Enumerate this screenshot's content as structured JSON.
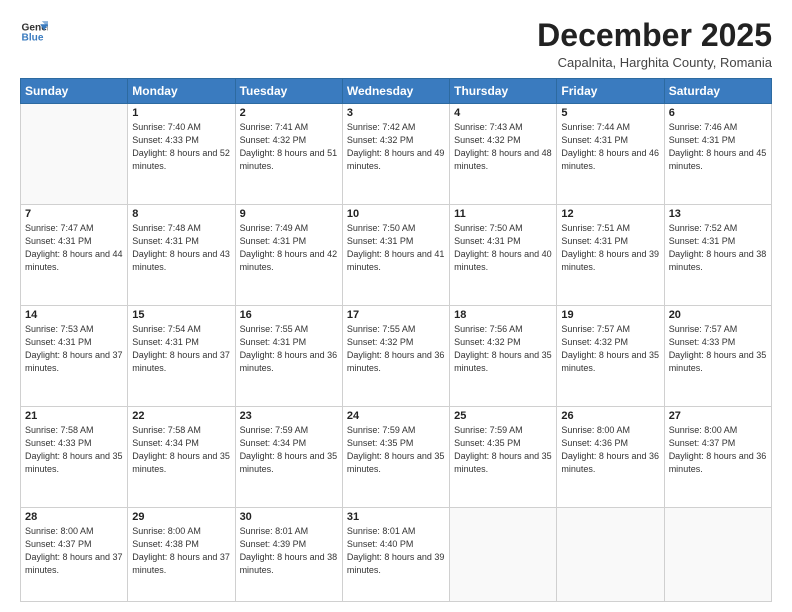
{
  "header": {
    "logo_line1": "General",
    "logo_line2": "Blue",
    "month": "December 2025",
    "location": "Capalnita, Harghita County, Romania"
  },
  "weekdays": [
    "Sunday",
    "Monday",
    "Tuesday",
    "Wednesday",
    "Thursday",
    "Friday",
    "Saturday"
  ],
  "weeks": [
    [
      {
        "day": "",
        "sunrise": "",
        "sunset": "",
        "daylight": ""
      },
      {
        "day": "1",
        "sunrise": "Sunrise: 7:40 AM",
        "sunset": "Sunset: 4:33 PM",
        "daylight": "Daylight: 8 hours and 52 minutes."
      },
      {
        "day": "2",
        "sunrise": "Sunrise: 7:41 AM",
        "sunset": "Sunset: 4:32 PM",
        "daylight": "Daylight: 8 hours and 51 minutes."
      },
      {
        "day": "3",
        "sunrise": "Sunrise: 7:42 AM",
        "sunset": "Sunset: 4:32 PM",
        "daylight": "Daylight: 8 hours and 49 minutes."
      },
      {
        "day": "4",
        "sunrise": "Sunrise: 7:43 AM",
        "sunset": "Sunset: 4:32 PM",
        "daylight": "Daylight: 8 hours and 48 minutes."
      },
      {
        "day": "5",
        "sunrise": "Sunrise: 7:44 AM",
        "sunset": "Sunset: 4:31 PM",
        "daylight": "Daylight: 8 hours and 46 minutes."
      },
      {
        "day": "6",
        "sunrise": "Sunrise: 7:46 AM",
        "sunset": "Sunset: 4:31 PM",
        "daylight": "Daylight: 8 hours and 45 minutes."
      }
    ],
    [
      {
        "day": "7",
        "sunrise": "Sunrise: 7:47 AM",
        "sunset": "Sunset: 4:31 PM",
        "daylight": "Daylight: 8 hours and 44 minutes."
      },
      {
        "day": "8",
        "sunrise": "Sunrise: 7:48 AM",
        "sunset": "Sunset: 4:31 PM",
        "daylight": "Daylight: 8 hours and 43 minutes."
      },
      {
        "day": "9",
        "sunrise": "Sunrise: 7:49 AM",
        "sunset": "Sunset: 4:31 PM",
        "daylight": "Daylight: 8 hours and 42 minutes."
      },
      {
        "day": "10",
        "sunrise": "Sunrise: 7:50 AM",
        "sunset": "Sunset: 4:31 PM",
        "daylight": "Daylight: 8 hours and 41 minutes."
      },
      {
        "day": "11",
        "sunrise": "Sunrise: 7:50 AM",
        "sunset": "Sunset: 4:31 PM",
        "daylight": "Daylight: 8 hours and 40 minutes."
      },
      {
        "day": "12",
        "sunrise": "Sunrise: 7:51 AM",
        "sunset": "Sunset: 4:31 PM",
        "daylight": "Daylight: 8 hours and 39 minutes."
      },
      {
        "day": "13",
        "sunrise": "Sunrise: 7:52 AM",
        "sunset": "Sunset: 4:31 PM",
        "daylight": "Daylight: 8 hours and 38 minutes."
      }
    ],
    [
      {
        "day": "14",
        "sunrise": "Sunrise: 7:53 AM",
        "sunset": "Sunset: 4:31 PM",
        "daylight": "Daylight: 8 hours and 37 minutes."
      },
      {
        "day": "15",
        "sunrise": "Sunrise: 7:54 AM",
        "sunset": "Sunset: 4:31 PM",
        "daylight": "Daylight: 8 hours and 37 minutes."
      },
      {
        "day": "16",
        "sunrise": "Sunrise: 7:55 AM",
        "sunset": "Sunset: 4:31 PM",
        "daylight": "Daylight: 8 hours and 36 minutes."
      },
      {
        "day": "17",
        "sunrise": "Sunrise: 7:55 AM",
        "sunset": "Sunset: 4:32 PM",
        "daylight": "Daylight: 8 hours and 36 minutes."
      },
      {
        "day": "18",
        "sunrise": "Sunrise: 7:56 AM",
        "sunset": "Sunset: 4:32 PM",
        "daylight": "Daylight: 8 hours and 35 minutes."
      },
      {
        "day": "19",
        "sunrise": "Sunrise: 7:57 AM",
        "sunset": "Sunset: 4:32 PM",
        "daylight": "Daylight: 8 hours and 35 minutes."
      },
      {
        "day": "20",
        "sunrise": "Sunrise: 7:57 AM",
        "sunset": "Sunset: 4:33 PM",
        "daylight": "Daylight: 8 hours and 35 minutes."
      }
    ],
    [
      {
        "day": "21",
        "sunrise": "Sunrise: 7:58 AM",
        "sunset": "Sunset: 4:33 PM",
        "daylight": "Daylight: 8 hours and 35 minutes."
      },
      {
        "day": "22",
        "sunrise": "Sunrise: 7:58 AM",
        "sunset": "Sunset: 4:34 PM",
        "daylight": "Daylight: 8 hours and 35 minutes."
      },
      {
        "day": "23",
        "sunrise": "Sunrise: 7:59 AM",
        "sunset": "Sunset: 4:34 PM",
        "daylight": "Daylight: 8 hours and 35 minutes."
      },
      {
        "day": "24",
        "sunrise": "Sunrise: 7:59 AM",
        "sunset": "Sunset: 4:35 PM",
        "daylight": "Daylight: 8 hours and 35 minutes."
      },
      {
        "day": "25",
        "sunrise": "Sunrise: 7:59 AM",
        "sunset": "Sunset: 4:35 PM",
        "daylight": "Daylight: 8 hours and 35 minutes."
      },
      {
        "day": "26",
        "sunrise": "Sunrise: 8:00 AM",
        "sunset": "Sunset: 4:36 PM",
        "daylight": "Daylight: 8 hours and 36 minutes."
      },
      {
        "day": "27",
        "sunrise": "Sunrise: 8:00 AM",
        "sunset": "Sunset: 4:37 PM",
        "daylight": "Daylight: 8 hours and 36 minutes."
      }
    ],
    [
      {
        "day": "28",
        "sunrise": "Sunrise: 8:00 AM",
        "sunset": "Sunset: 4:37 PM",
        "daylight": "Daylight: 8 hours and 37 minutes."
      },
      {
        "day": "29",
        "sunrise": "Sunrise: 8:00 AM",
        "sunset": "Sunset: 4:38 PM",
        "daylight": "Daylight: 8 hours and 37 minutes."
      },
      {
        "day": "30",
        "sunrise": "Sunrise: 8:01 AM",
        "sunset": "Sunset: 4:39 PM",
        "daylight": "Daylight: 8 hours and 38 minutes."
      },
      {
        "day": "31",
        "sunrise": "Sunrise: 8:01 AM",
        "sunset": "Sunset: 4:40 PM",
        "daylight": "Daylight: 8 hours and 39 minutes."
      },
      {
        "day": "",
        "sunrise": "",
        "sunset": "",
        "daylight": ""
      },
      {
        "day": "",
        "sunrise": "",
        "sunset": "",
        "daylight": ""
      },
      {
        "day": "",
        "sunrise": "",
        "sunset": "",
        "daylight": ""
      }
    ]
  ]
}
